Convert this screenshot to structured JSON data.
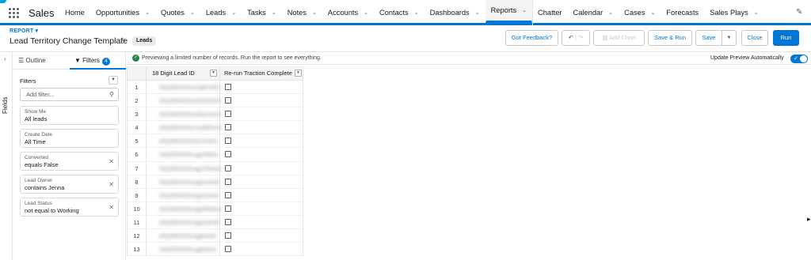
{
  "app": {
    "name": "Sales"
  },
  "nav": {
    "items": [
      {
        "label": "Home",
        "chevron": false
      },
      {
        "label": "Opportunities",
        "chevron": true
      },
      {
        "label": "Quotes",
        "chevron": true
      },
      {
        "label": "Leads",
        "chevron": true
      },
      {
        "label": "Tasks",
        "chevron": true
      },
      {
        "label": "Notes",
        "chevron": true
      },
      {
        "label": "Accounts",
        "chevron": true
      },
      {
        "label": "Contacts",
        "chevron": true
      },
      {
        "label": "Dashboards",
        "chevron": true
      },
      {
        "label": "Reports",
        "chevron": true,
        "active": true
      },
      {
        "label": "Chatter",
        "chevron": false
      },
      {
        "label": "Calendar",
        "chevron": true
      },
      {
        "label": "Cases",
        "chevron": true
      },
      {
        "label": "Forecasts",
        "chevron": false
      },
      {
        "label": "Sales Plays",
        "chevron": true
      }
    ]
  },
  "report": {
    "type_label": "REPORT",
    "title": "Lead Territory Change Template",
    "object_pill": "Leads"
  },
  "toolbar": {
    "feedback": "Got Feedback?",
    "add_chart": "Add Chart",
    "save_run": "Save & Run",
    "save": "Save",
    "close": "Close",
    "run": "Run"
  },
  "sidebar": {
    "fields_label": "Fields"
  },
  "panel": {
    "tab_outline": "Outline",
    "tab_filters": "Filters",
    "filters_count": "4",
    "filters_heading": "Filters",
    "add_filter_placeholder": "Add filter...",
    "filters": [
      {
        "field": "Show Me",
        "value": "All leads",
        "removable": false
      },
      {
        "field": "Create Date",
        "value": "All Time",
        "removable": false
      },
      {
        "field": "Converted",
        "value": "equals False",
        "removable": true
      },
      {
        "field": "Lead Owner",
        "value": "contains Jenna",
        "removable": true
      },
      {
        "field": "Lead Status",
        "value": "not equal to Working",
        "removable": true
      }
    ]
  },
  "preview": {
    "message": "Previewing a limited number of records. Run the report to see everything.",
    "auto_update_label": "Update Preview Automatically",
    "auto_update_on": true
  },
  "table": {
    "columns": [
      "18 Digit Lead ID",
      "Re-run Traction Complete"
    ],
    "rows": [
      {
        "n": "1",
        "id": "00Q3l00000sXaBHNE1",
        "checked": false
      },
      {
        "n": "2",
        "id": "00Q3l00000sXbD8XEA",
        "checked": false
      },
      {
        "n": "3",
        "id": "00Q3l00000ux8ysrAAA",
        "checked": false
      },
      {
        "n": "4",
        "id": "00Q3l00000cmvBRkAA",
        "checked": false
      },
      {
        "n": "5",
        "id": "00Q3l00000uhCDnEA",
        "checked": false
      },
      {
        "n": "6",
        "id": "00Q3l00000vqgXNlAA",
        "checked": false
      },
      {
        "n": "7",
        "id": "00Q3l00000vqgYPAAG",
        "checked": false
      },
      {
        "n": "8",
        "id": "00Q3l00000vqgZeAAE",
        "checked": false
      },
      {
        "n": "9",
        "id": "00Q3l00000vqgZrAAA",
        "checked": false
      },
      {
        "n": "10",
        "id": "00Q3l00000vqgMRdAA",
        "checked": false
      },
      {
        "n": "11",
        "id": "00Q3l00000vqgZoEAE",
        "checked": false
      },
      {
        "n": "12",
        "id": "00Q3l00000vqgbAAA",
        "checked": false
      },
      {
        "n": "13",
        "id": "00Q3l00000vqgKbAA",
        "checked": false
      }
    ]
  },
  "colors": {
    "brand": "#0176d3",
    "success": "#2e844a",
    "nav_active_bg": "#f3f3f3"
  }
}
